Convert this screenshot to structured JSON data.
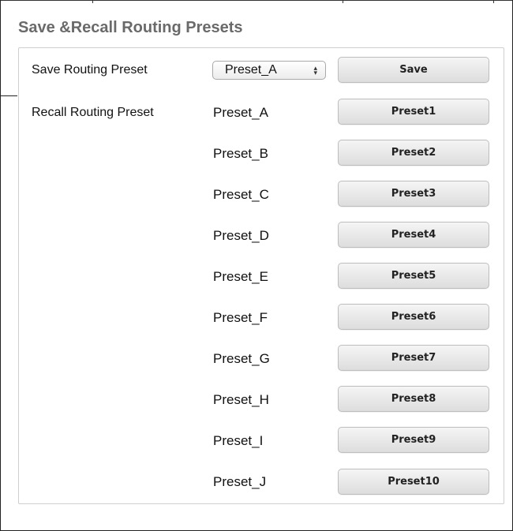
{
  "panel": {
    "title": "Save &Recall Routing Presets"
  },
  "save_row": {
    "label": "Save Routing Preset",
    "select_value": "Preset_A",
    "save_label": "Save"
  },
  "recall_row": {
    "label": "Recall Routing Preset"
  },
  "presets": [
    {
      "name": "Preset_A",
      "button": "Preset1"
    },
    {
      "name": "Preset_B",
      "button": "Preset2"
    },
    {
      "name": "Preset_C",
      "button": "Preset3"
    },
    {
      "name": "Preset_D",
      "button": "Preset4"
    },
    {
      "name": "Preset_E",
      "button": "Preset5"
    },
    {
      "name": "Preset_F",
      "button": "Preset6"
    },
    {
      "name": "Preset_G",
      "button": "Preset7"
    },
    {
      "name": "Preset_H",
      "button": "Preset8"
    },
    {
      "name": "Preset_I",
      "button": "Preset9"
    },
    {
      "name": "Preset_J",
      "button": "Preset10"
    }
  ]
}
